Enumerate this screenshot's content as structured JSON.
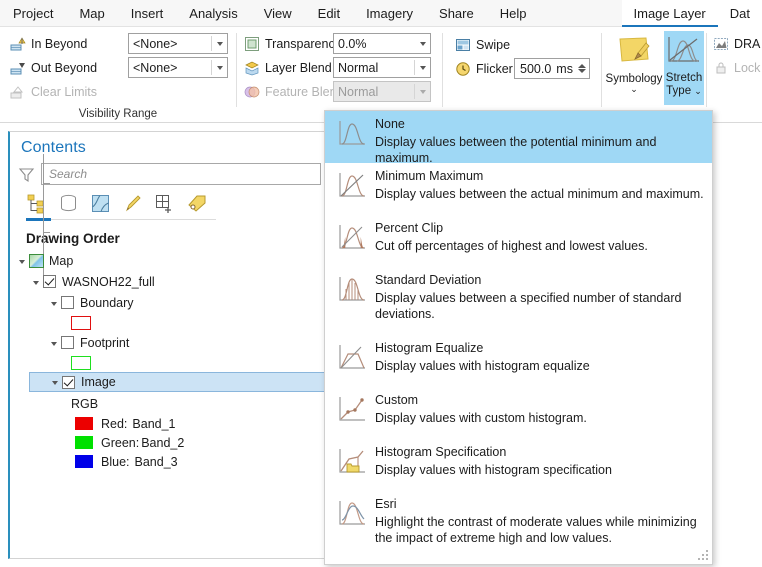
{
  "menu": {
    "items": [
      {
        "label": "Project"
      },
      {
        "label": "Map"
      },
      {
        "label": "Insert"
      },
      {
        "label": "Analysis"
      },
      {
        "label": "View"
      },
      {
        "label": "Edit"
      },
      {
        "label": "Imagery"
      },
      {
        "label": "Share"
      },
      {
        "label": "Help"
      }
    ],
    "tabs": [
      {
        "label": "Image Layer",
        "active": true
      },
      {
        "label": "Dat",
        "active": false
      }
    ]
  },
  "ribbon": {
    "visibility_group": {
      "label": "Visibility Range",
      "in_beyond_label": "In Beyond",
      "in_beyond_value": "<None>",
      "out_beyond_label": "Out Beyond",
      "out_beyond_value": "<None>",
      "clear_limits_label": "Clear Limits"
    },
    "effects_group": {
      "transparency_label": "Transparency",
      "transparency_value": "0.0%",
      "layer_blend_label": "Layer Blend",
      "layer_blend_value": "Normal",
      "feature_blend_label": "Feature Blend",
      "feature_blend_value": "Normal"
    },
    "compare_group": {
      "swipe_label": "Swipe",
      "flicker_label": "Flicker",
      "flicker_value": "500.0",
      "flicker_unit": "ms"
    },
    "rendering_group": {
      "symbology_label": "Symbology",
      "stretch_type_label_line1": "Stretch",
      "stretch_type_label_line2": "Type",
      "dra_label": "DRA",
      "lock_label": "Lock"
    }
  },
  "contents": {
    "title": "Contents",
    "search_placeholder": "Search",
    "search_value": "",
    "toolbar_icons": [
      "list-by-drawing-order-icon",
      "list-by-data-source-icon",
      "list-by-selection-icon",
      "list-by-editing-icon",
      "list-by-snapping-icon",
      "list-by-labeling-icon"
    ],
    "drawing_order_label": "Drawing Order",
    "tree": {
      "map_label": "Map",
      "layer_label": "WASNOH22_full",
      "layer_checked": true,
      "children": [
        {
          "label": "Boundary",
          "checked": false,
          "swatch_color": "#e01010",
          "swatch_type": "outline"
        },
        {
          "label": "Footprint",
          "checked": false,
          "swatch_color": "#1fdf1f",
          "swatch_type": "outline"
        },
        {
          "label": "Image",
          "checked": true,
          "selected": true
        }
      ],
      "rgb_label": "RGB",
      "bands": [
        {
          "color": "#ec0000",
          "label": "Red:",
          "band": "Band_1"
        },
        {
          "color": "#00e000",
          "label": "Green:",
          "band": "Band_2"
        },
        {
          "color": "#0000e8",
          "label": "Blue:",
          "band": "Band_3"
        }
      ]
    }
  },
  "stretch_dropdown": {
    "items": [
      {
        "title": "None",
        "description": "Display values between the potential minimum and maximum.",
        "icon": "histogram-none-icon",
        "highlighted": true
      },
      {
        "title": "Minimum Maximum",
        "description": "Display values between the actual minimum and maximum.",
        "icon": "histogram-minmax-icon",
        "highlighted": false
      },
      {
        "title": "Percent Clip",
        "description": "Cut off percentages of highest and lowest values.",
        "icon": "histogram-percent-clip-icon",
        "highlighted": false
      },
      {
        "title": "Standard Deviation",
        "description": "Display values between a specified number of standard deviations.",
        "icon": "histogram-std-dev-icon",
        "highlighted": false
      },
      {
        "title": "Histogram Equalize",
        "description": "Display values with histogram equalize",
        "icon": "histogram-equalize-icon",
        "highlighted": false
      },
      {
        "title": "Custom",
        "description": "Display values with custom histogram.",
        "icon": "histogram-custom-icon",
        "highlighted": false
      },
      {
        "title": "Histogram Specification",
        "description": "Display values with histogram specification",
        "icon": "histogram-specification-icon",
        "highlighted": false
      },
      {
        "title": "Esri",
        "description": "Highlight the contrast of moderate values while minimizing the impact of extreme high and low values.",
        "icon": "histogram-esri-icon",
        "highlighted": false
      }
    ]
  },
  "colors": {
    "accent": "#1b75bb",
    "highlight": "#9fd8f5",
    "selection": "#cce3f5"
  }
}
